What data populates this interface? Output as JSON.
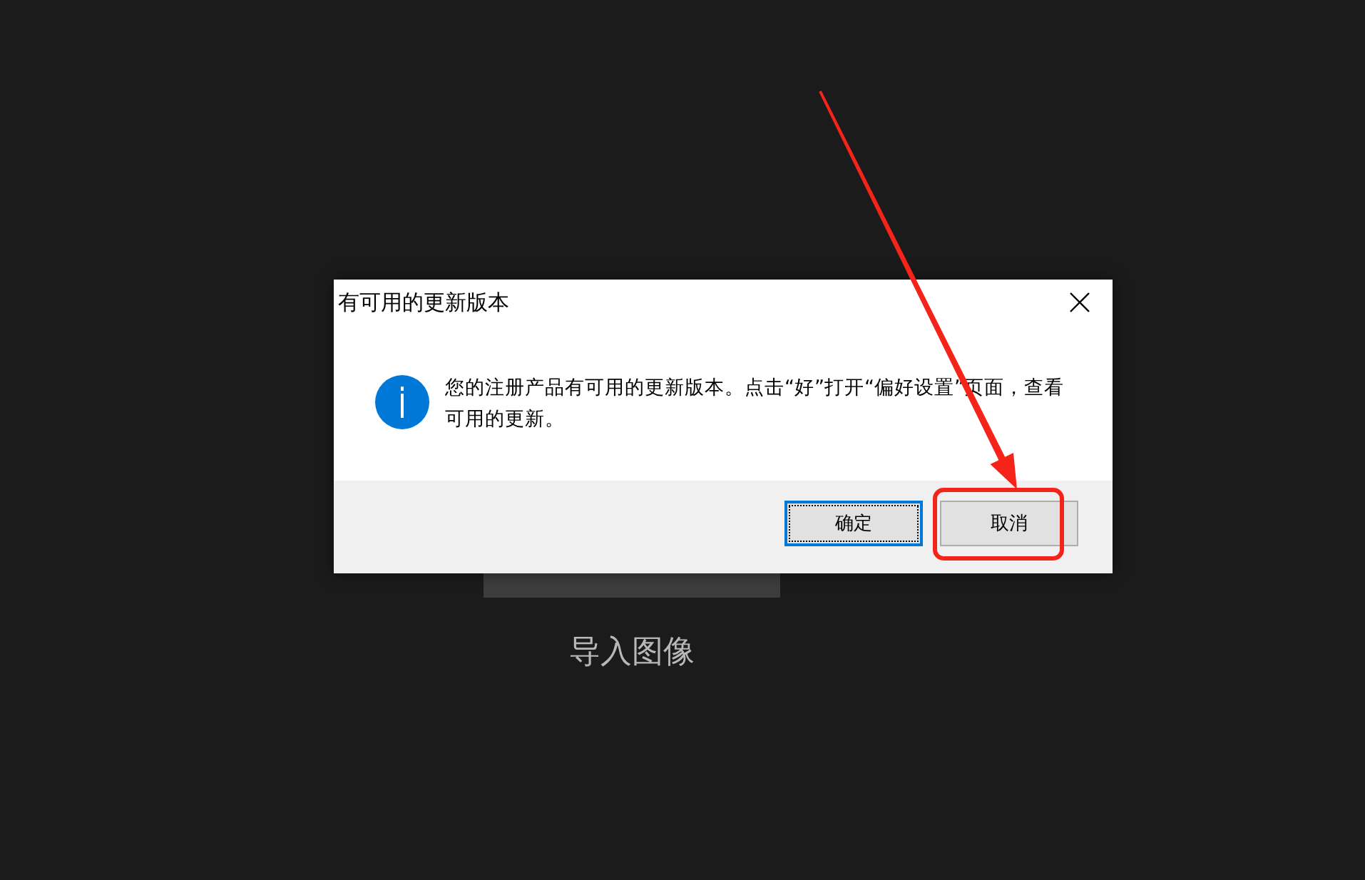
{
  "background": {
    "label": "导入图像"
  },
  "dialog": {
    "title": "有可用的更新版本",
    "message": "您的注册产品有可用的更新版本。点击“好”打开“偏好设置”页面，查看可用的更新。",
    "buttons": [
      {
        "label": "确定",
        "focused": true
      },
      {
        "label": "取消",
        "focused": false
      }
    ]
  }
}
